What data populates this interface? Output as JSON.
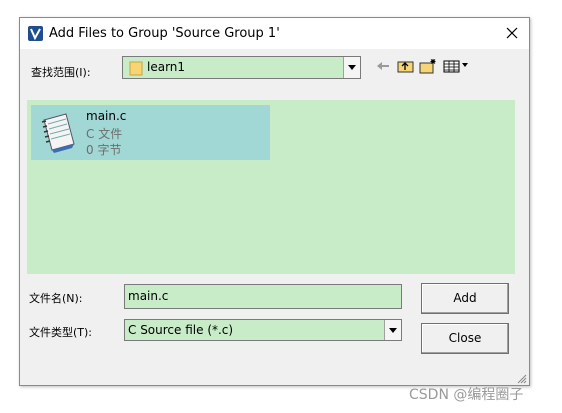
{
  "window": {
    "title": "Add Files to Group 'Source Group 1'"
  },
  "look_in": {
    "label": "查找范围(I):",
    "value": "learn1"
  },
  "toolbar": {
    "icons": [
      "back-arrow-icon",
      "up-folder-icon",
      "new-folder-icon",
      "view-menu-icon"
    ]
  },
  "file_list": {
    "items": [
      {
        "name": "main.c",
        "type": "C 文件",
        "size": "0 字节",
        "selected": true
      }
    ]
  },
  "filename": {
    "label": "文件名(N):",
    "value": "main.c"
  },
  "filetype": {
    "label": "文件类型(T):",
    "value": "C Source file (*.c)"
  },
  "buttons": {
    "add": "Add",
    "close": "Close"
  },
  "watermark": "CSDN @编程圈子",
  "colors": {
    "field_bg": "#c8ebc8",
    "selection_bg": "#a1d7d4",
    "dialog_bg": "#f0f0f0"
  }
}
